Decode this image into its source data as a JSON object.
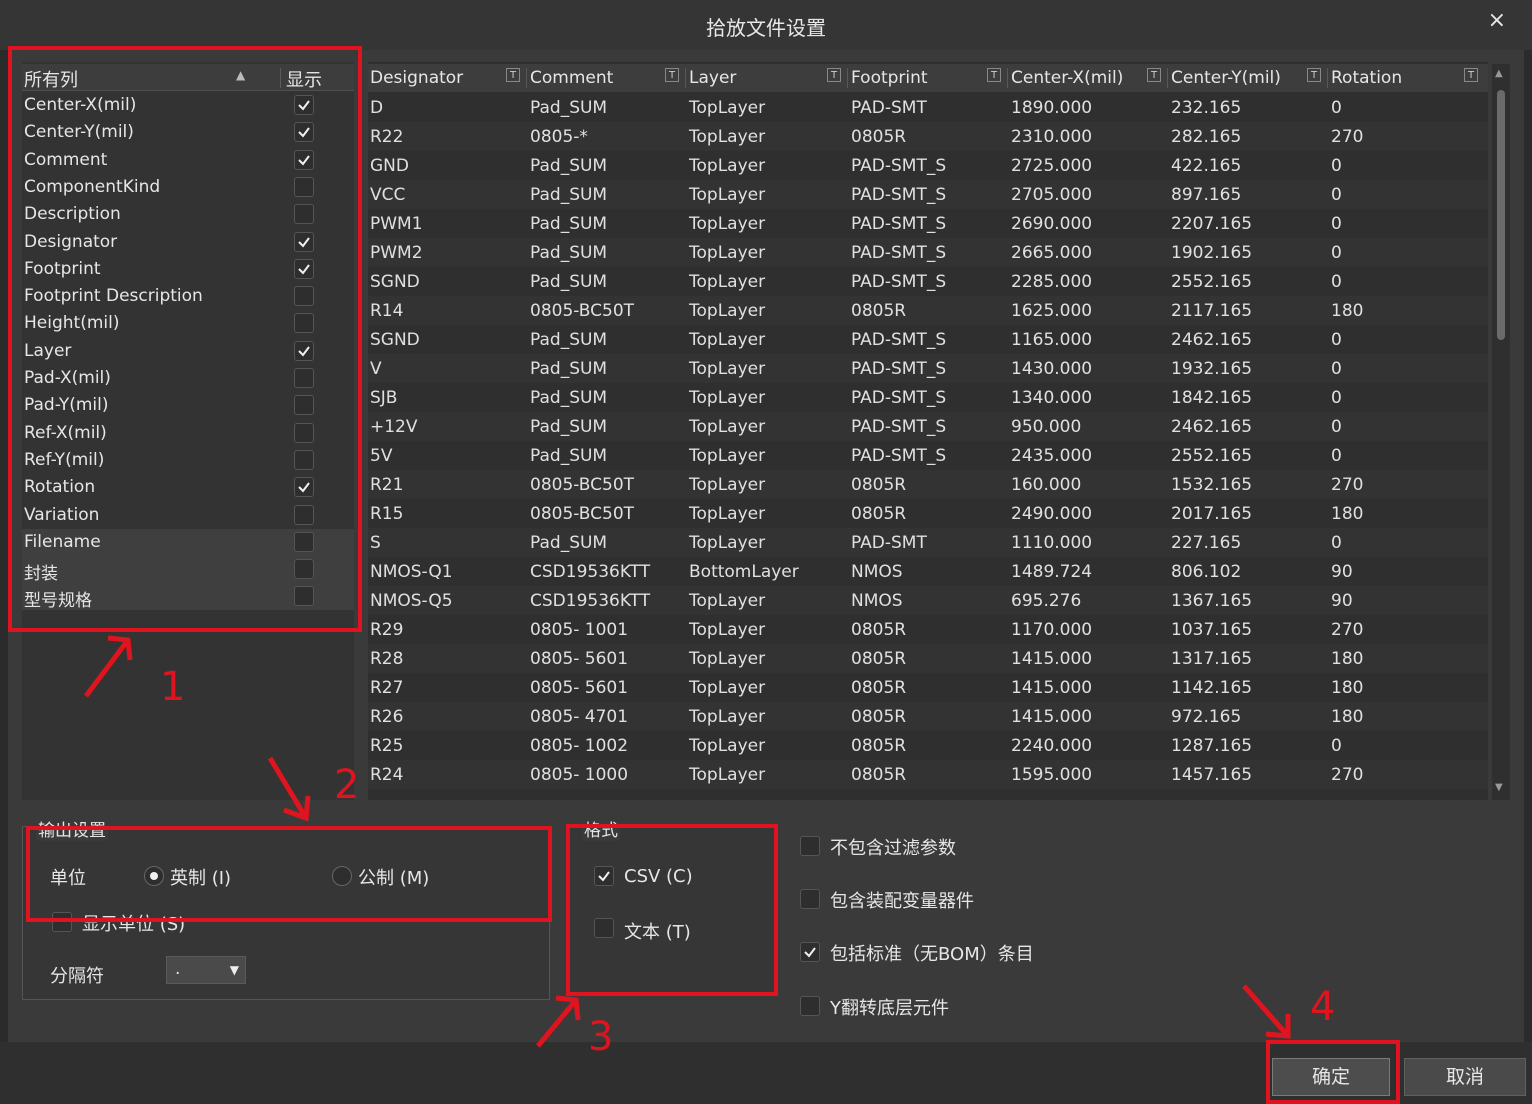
{
  "dialog": {
    "title": "拾放文件设置",
    "close_symbol": "×"
  },
  "columns_panel": {
    "header_all": "所有列",
    "header_show": "显示",
    "items": [
      {
        "label": "Center-X(mil)",
        "checked": true
      },
      {
        "label": "Center-Y(mil)",
        "checked": true
      },
      {
        "label": "Comment",
        "checked": true
      },
      {
        "label": "ComponentKind",
        "checked": false
      },
      {
        "label": "Description",
        "checked": false
      },
      {
        "label": "Designator",
        "checked": true
      },
      {
        "label": "Footprint",
        "checked": true
      },
      {
        "label": "Footprint Description",
        "checked": false
      },
      {
        "label": "Height(mil)",
        "checked": false
      },
      {
        "label": "Layer",
        "checked": true
      },
      {
        "label": "Pad-X(mil)",
        "checked": false
      },
      {
        "label": "Pad-Y(mil)",
        "checked": false
      },
      {
        "label": "Ref-X(mil)",
        "checked": false
      },
      {
        "label": "Ref-Y(mil)",
        "checked": false
      },
      {
        "label": "Rotation",
        "checked": true
      },
      {
        "label": "Variation",
        "checked": false
      },
      {
        "label": "Filename",
        "checked": false
      },
      {
        "label": "封装",
        "checked": false
      },
      {
        "label": "型号规格",
        "checked": false
      }
    ]
  },
  "table": {
    "columns": [
      "Designator",
      "Comment",
      "Layer",
      "Footprint",
      "Center-X(mil)",
      "Center-Y(mil)",
      "Rotation"
    ],
    "rows": [
      [
        "D",
        "Pad_SUM",
        "TopLayer",
        "PAD-SMT",
        "1890.000",
        "232.165",
        "0"
      ],
      [
        "R22",
        "0805-*",
        "TopLayer",
        "0805R",
        "2310.000",
        "282.165",
        "270"
      ],
      [
        "GND",
        "Pad_SUM",
        "TopLayer",
        "PAD-SMT_S",
        "2725.000",
        "422.165",
        "0"
      ],
      [
        "VCC",
        "Pad_SUM",
        "TopLayer",
        "PAD-SMT_S",
        "2705.000",
        "897.165",
        "0"
      ],
      [
        "PWM1",
        "Pad_SUM",
        "TopLayer",
        "PAD-SMT_S",
        "2690.000",
        "2207.165",
        "0"
      ],
      [
        "PWM2",
        "Pad_SUM",
        "TopLayer",
        "PAD-SMT_S",
        "2665.000",
        "1902.165",
        "0"
      ],
      [
        "SGND",
        "Pad_SUM",
        "TopLayer",
        "PAD-SMT_S",
        "2285.000",
        "2552.165",
        "0"
      ],
      [
        "R14",
        "0805-BC50T",
        "TopLayer",
        "0805R",
        "1625.000",
        "2117.165",
        "180"
      ],
      [
        "SGND",
        "Pad_SUM",
        "TopLayer",
        "PAD-SMT_S",
        "1165.000",
        "2462.165",
        "0"
      ],
      [
        "V",
        "Pad_SUM",
        "TopLayer",
        "PAD-SMT_S",
        "1430.000",
        "1932.165",
        "0"
      ],
      [
        "SJB",
        "Pad_SUM",
        "TopLayer",
        "PAD-SMT_S",
        "1340.000",
        "1842.165",
        "0"
      ],
      [
        "+12V",
        "Pad_SUM",
        "TopLayer",
        "PAD-SMT_S",
        "950.000",
        "2462.165",
        "0"
      ],
      [
        "5V",
        "Pad_SUM",
        "TopLayer",
        "PAD-SMT_S",
        "2435.000",
        "2552.165",
        "0"
      ],
      [
        "R21",
        "0805-BC50T",
        "TopLayer",
        "0805R",
        "160.000",
        "1532.165",
        "270"
      ],
      [
        "R15",
        "0805-BC50T",
        "TopLayer",
        "0805R",
        "2490.000",
        "2017.165",
        "180"
      ],
      [
        "S",
        "Pad_SUM",
        "TopLayer",
        "PAD-SMT",
        "1110.000",
        "227.165",
        "0"
      ],
      [
        "NMOS-Q1",
        "CSD19536KTT",
        "BottomLayer",
        "NMOS",
        "1489.724",
        "806.102",
        "90"
      ],
      [
        "NMOS-Q5",
        "CSD19536KTT",
        "TopLayer",
        "NMOS",
        "695.276",
        "1367.165",
        "90"
      ],
      [
        "R29",
        "0805- 1001",
        "TopLayer",
        "0805R",
        "1170.000",
        "1037.165",
        "270"
      ],
      [
        "R28",
        "0805- 5601",
        "TopLayer",
        "0805R",
        "1415.000",
        "1317.165",
        "180"
      ],
      [
        "R27",
        "0805- 5601",
        "TopLayer",
        "0805R",
        "1415.000",
        "1142.165",
        "180"
      ],
      [
        "R26",
        "0805- 4701",
        "TopLayer",
        "0805R",
        "1415.000",
        "972.165",
        "180"
      ],
      [
        "R25",
        "0805- 1002",
        "TopLayer",
        "0805R",
        "2240.000",
        "1287.165",
        "0"
      ],
      [
        "R24",
        "0805- 1000",
        "TopLayer",
        "0805R",
        "1595.000",
        "1457.165",
        "270"
      ]
    ]
  },
  "output": {
    "group_title": "输出设置",
    "unit_label": "单位",
    "imperial_label": "英制 (I)",
    "metric_label": "公制 (M)",
    "imperial_selected": true,
    "show_units_label": "显示单位 (S)",
    "separator_label": "分隔符",
    "separator_value": "."
  },
  "format": {
    "group_title": "格式",
    "csv_label": "CSV (C)",
    "csv_checked": true,
    "text_label": "文本 (T)",
    "text_checked": false
  },
  "options": [
    {
      "label": "不包含过滤参数",
      "checked": false
    },
    {
      "label": "包含装配变量器件",
      "checked": false
    },
    {
      "label": "包括标准（无BOM）条目",
      "checked": true
    },
    {
      "label": "Y翻转底层元件",
      "checked": false
    }
  ],
  "buttons": {
    "ok": "确定",
    "cancel": "取消"
  },
  "annotations": [
    "1",
    "2",
    "3",
    "4"
  ],
  "colors": {
    "annotation_red": "#e0141e",
    "background": "#3a3a3a"
  }
}
